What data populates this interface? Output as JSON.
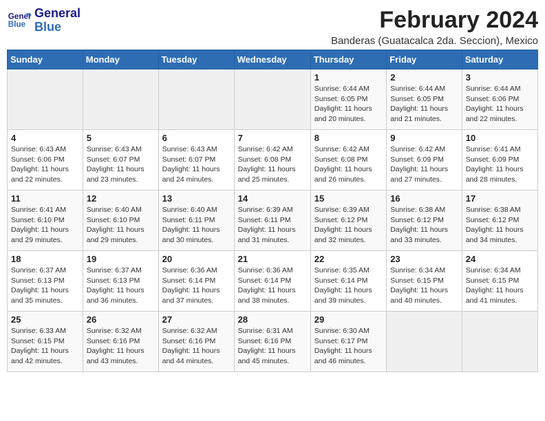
{
  "header": {
    "logo_line1": "General",
    "logo_line2": "Blue",
    "main_title": "February 2024",
    "subtitle": "Banderas (Guatacalca 2da. Seccion), Mexico"
  },
  "weekdays": [
    "Sunday",
    "Monday",
    "Tuesday",
    "Wednesday",
    "Thursday",
    "Friday",
    "Saturday"
  ],
  "weeks": [
    [
      {
        "day": "",
        "info": ""
      },
      {
        "day": "",
        "info": ""
      },
      {
        "day": "",
        "info": ""
      },
      {
        "day": "",
        "info": ""
      },
      {
        "day": "1",
        "info": "Sunrise: 6:44 AM\nSunset: 6:05 PM\nDaylight: 11 hours and 20 minutes."
      },
      {
        "day": "2",
        "info": "Sunrise: 6:44 AM\nSunset: 6:05 PM\nDaylight: 11 hours and 21 minutes."
      },
      {
        "day": "3",
        "info": "Sunrise: 6:44 AM\nSunset: 6:06 PM\nDaylight: 11 hours and 22 minutes."
      }
    ],
    [
      {
        "day": "4",
        "info": "Sunrise: 6:43 AM\nSunset: 6:06 PM\nDaylight: 11 hours and 22 minutes."
      },
      {
        "day": "5",
        "info": "Sunrise: 6:43 AM\nSunset: 6:07 PM\nDaylight: 11 hours and 23 minutes."
      },
      {
        "day": "6",
        "info": "Sunrise: 6:43 AM\nSunset: 6:07 PM\nDaylight: 11 hours and 24 minutes."
      },
      {
        "day": "7",
        "info": "Sunrise: 6:42 AM\nSunset: 6:08 PM\nDaylight: 11 hours and 25 minutes."
      },
      {
        "day": "8",
        "info": "Sunrise: 6:42 AM\nSunset: 6:08 PM\nDaylight: 11 hours and 26 minutes."
      },
      {
        "day": "9",
        "info": "Sunrise: 6:42 AM\nSunset: 6:09 PM\nDaylight: 11 hours and 27 minutes."
      },
      {
        "day": "10",
        "info": "Sunrise: 6:41 AM\nSunset: 6:09 PM\nDaylight: 11 hours and 28 minutes."
      }
    ],
    [
      {
        "day": "11",
        "info": "Sunrise: 6:41 AM\nSunset: 6:10 PM\nDaylight: 11 hours and 29 minutes."
      },
      {
        "day": "12",
        "info": "Sunrise: 6:40 AM\nSunset: 6:10 PM\nDaylight: 11 hours and 29 minutes."
      },
      {
        "day": "13",
        "info": "Sunrise: 6:40 AM\nSunset: 6:11 PM\nDaylight: 11 hours and 30 minutes."
      },
      {
        "day": "14",
        "info": "Sunrise: 6:39 AM\nSunset: 6:11 PM\nDaylight: 11 hours and 31 minutes."
      },
      {
        "day": "15",
        "info": "Sunrise: 6:39 AM\nSunset: 6:12 PM\nDaylight: 11 hours and 32 minutes."
      },
      {
        "day": "16",
        "info": "Sunrise: 6:38 AM\nSunset: 6:12 PM\nDaylight: 11 hours and 33 minutes."
      },
      {
        "day": "17",
        "info": "Sunrise: 6:38 AM\nSunset: 6:12 PM\nDaylight: 11 hours and 34 minutes."
      }
    ],
    [
      {
        "day": "18",
        "info": "Sunrise: 6:37 AM\nSunset: 6:13 PM\nDaylight: 11 hours and 35 minutes."
      },
      {
        "day": "19",
        "info": "Sunrise: 6:37 AM\nSunset: 6:13 PM\nDaylight: 11 hours and 36 minutes."
      },
      {
        "day": "20",
        "info": "Sunrise: 6:36 AM\nSunset: 6:14 PM\nDaylight: 11 hours and 37 minutes."
      },
      {
        "day": "21",
        "info": "Sunrise: 6:36 AM\nSunset: 6:14 PM\nDaylight: 11 hours and 38 minutes."
      },
      {
        "day": "22",
        "info": "Sunrise: 6:35 AM\nSunset: 6:14 PM\nDaylight: 11 hours and 39 minutes."
      },
      {
        "day": "23",
        "info": "Sunrise: 6:34 AM\nSunset: 6:15 PM\nDaylight: 11 hours and 40 minutes."
      },
      {
        "day": "24",
        "info": "Sunrise: 6:34 AM\nSunset: 6:15 PM\nDaylight: 11 hours and 41 minutes."
      }
    ],
    [
      {
        "day": "25",
        "info": "Sunrise: 6:33 AM\nSunset: 6:15 PM\nDaylight: 11 hours and 42 minutes."
      },
      {
        "day": "26",
        "info": "Sunrise: 6:32 AM\nSunset: 6:16 PM\nDaylight: 11 hours and 43 minutes."
      },
      {
        "day": "27",
        "info": "Sunrise: 6:32 AM\nSunset: 6:16 PM\nDaylight: 11 hours and 44 minutes."
      },
      {
        "day": "28",
        "info": "Sunrise: 6:31 AM\nSunset: 6:16 PM\nDaylight: 11 hours and 45 minutes."
      },
      {
        "day": "29",
        "info": "Sunrise: 6:30 AM\nSunset: 6:17 PM\nDaylight: 11 hours and 46 minutes."
      },
      {
        "day": "",
        "info": ""
      },
      {
        "day": "",
        "info": ""
      }
    ]
  ]
}
